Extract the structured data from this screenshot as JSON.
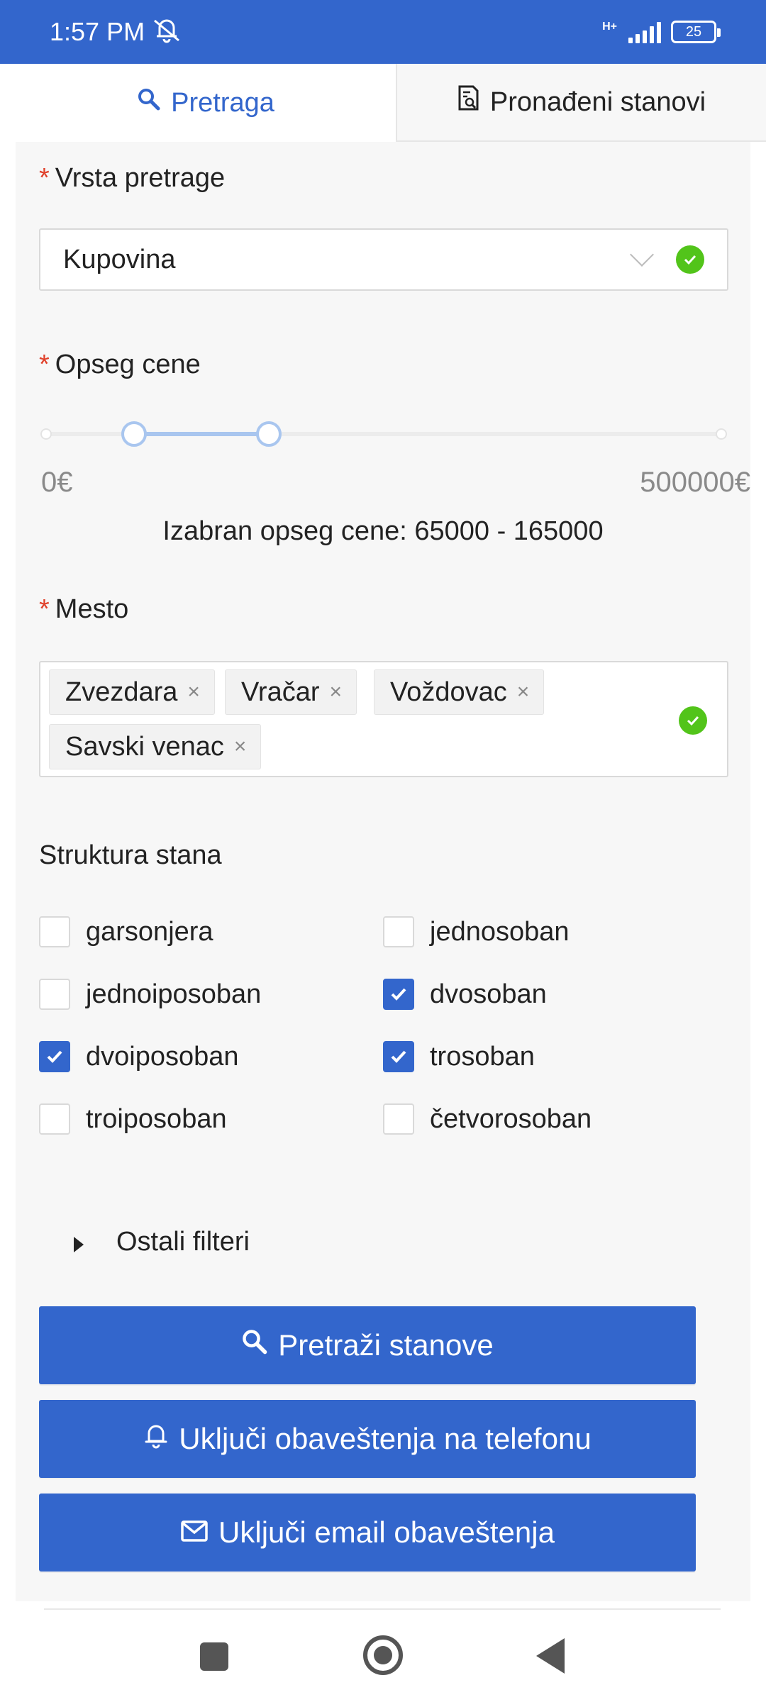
{
  "status_bar": {
    "time": "1:57 PM",
    "network": "H+",
    "battery": "25",
    "icons": [
      "alarm-off-icon",
      "signal-icon",
      "battery-icon"
    ]
  },
  "tabs": [
    {
      "label": "Pretraga",
      "icon": "search-icon",
      "active": true
    },
    {
      "label": "Pronađeni stanovi",
      "icon": "document-search-icon",
      "active": false
    }
  ],
  "form": {
    "required_mark": "*",
    "search_type": {
      "label": "Vrsta pretrage",
      "value": "Kupovina",
      "valid": true
    },
    "price_range": {
      "label": "Opseg cene",
      "min_label": "0€",
      "max_label": "500000€",
      "min": 0,
      "max": 500000,
      "selected_low": 65000,
      "selected_high": 165000,
      "selected_text": "Izabran opseg cene: 65000 - 165000"
    },
    "location": {
      "label": "Mesto",
      "tags": [
        "Zvezdara",
        "Vračar",
        "Voždovac",
        "Savski venac"
      ],
      "remove_glyph": "×",
      "valid": true
    },
    "structure": {
      "label": "Struktura stana",
      "options": [
        {
          "label": "garsonjera",
          "checked": false
        },
        {
          "label": "jednosoban",
          "checked": false
        },
        {
          "label": "jednoiposoban",
          "checked": false
        },
        {
          "label": "dvosoban",
          "checked": true
        },
        {
          "label": "dvoiposoban",
          "checked": true
        },
        {
          "label": "trosoban",
          "checked": true
        },
        {
          "label": "troiposoban",
          "checked": false
        },
        {
          "label": "četvorosoban",
          "checked": false
        }
      ]
    },
    "other_filters": {
      "label": "Ostali filteri",
      "expanded": false
    }
  },
  "buttons": {
    "search": {
      "label": "Pretraži stanove",
      "icon": "search-icon"
    },
    "phone_notifications": {
      "label": "Uključi obaveštenja na telefonu",
      "icon": "bell-icon"
    },
    "email_notifications": {
      "label": "Uključi email obaveštenja",
      "icon": "mail-icon"
    }
  },
  "colors": {
    "primary": "#3366cc",
    "success": "#52c41a",
    "required": "#e0402a",
    "slider_track": "#a9c6ef"
  }
}
